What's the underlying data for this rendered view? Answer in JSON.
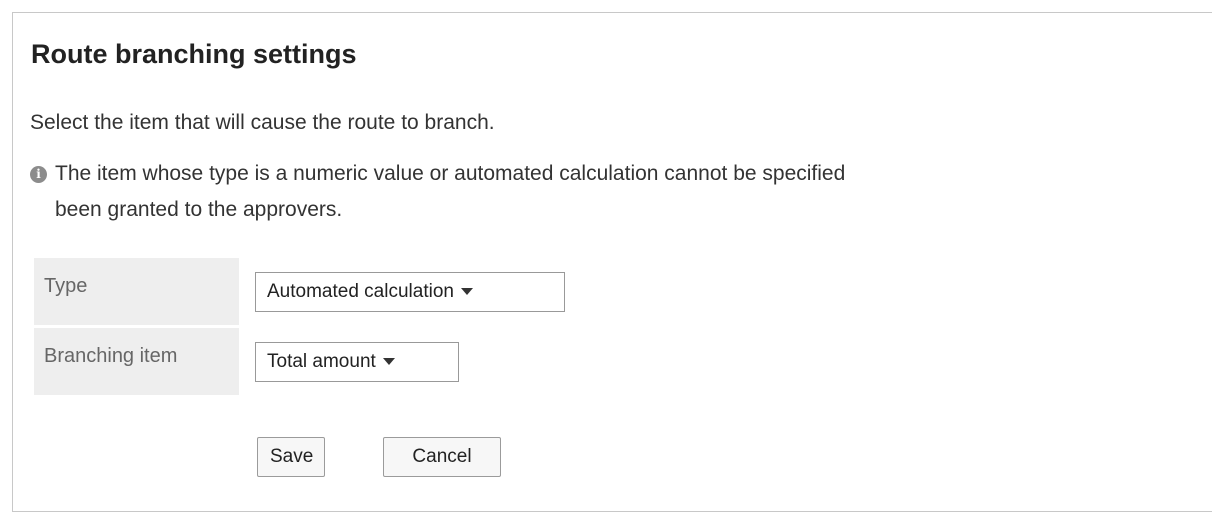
{
  "page": {
    "title": "Route branching settings",
    "description": "Select the item that will cause the route to branch.",
    "note": {
      "icon": "info-icon",
      "line1": "The item whose type is a numeric value or automated calculation cannot be specified",
      "line2": "been granted to the approvers."
    }
  },
  "form": {
    "type": {
      "label": "Type",
      "value": "Automated calculation"
    },
    "branching_item": {
      "label": "Branching item",
      "value": "Total amount"
    }
  },
  "buttons": {
    "save": "Save",
    "cancel": "Cancel"
  }
}
